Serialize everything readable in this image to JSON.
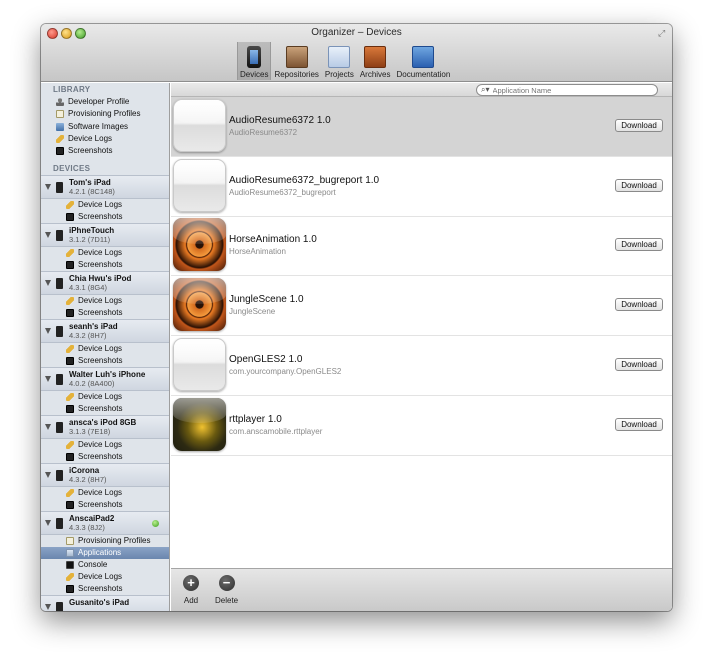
{
  "window": {
    "title": "Organizer – Devices"
  },
  "toolbar": [
    {
      "label": "Devices",
      "icon": "device-icon",
      "active": true
    },
    {
      "label": "Repositories",
      "icon": "repository-icon",
      "active": false
    },
    {
      "label": "Projects",
      "icon": "projects-icon",
      "active": false
    },
    {
      "label": "Archives",
      "icon": "archives-icon",
      "active": false
    },
    {
      "label": "Documentation",
      "icon": "documentation-icon",
      "active": false
    }
  ],
  "sidebar": {
    "library_header": "LIBRARY",
    "library": [
      {
        "label": "Developer Profile",
        "icon": "person-icon"
      },
      {
        "label": "Provisioning Profiles",
        "icon": "profile-icon"
      },
      {
        "label": "Software Images",
        "icon": "images-icon"
      },
      {
        "label": "Device Logs",
        "icon": "logs-icon"
      },
      {
        "label": "Screenshots",
        "icon": "screenshots-icon"
      }
    ],
    "devices_header": "DEVICES",
    "devices": [
      {
        "name": "Tom's iPad",
        "version": "4.2.1 (8C148)",
        "children": [
          "Device Logs",
          "Screenshots"
        ]
      },
      {
        "name": "iPhneTouch",
        "version": "3.1.2 (7D11)",
        "children": [
          "Device Logs",
          "Screenshots"
        ]
      },
      {
        "name": "Chia Hwu's iPod",
        "version": "4.3.1 (8G4)",
        "children": [
          "Device Logs",
          "Screenshots"
        ]
      },
      {
        "name": "seanh's iPad",
        "version": "4.3.2 (8H7)",
        "children": [
          "Device Logs",
          "Screenshots"
        ]
      },
      {
        "name": "Walter Luh's iPhone",
        "version": "4.0.2 (8A400)",
        "children": [
          "Device Logs",
          "Screenshots"
        ]
      },
      {
        "name": "ansca's iPod 8GB",
        "version": "3.1.3 (7E18)",
        "children": [
          "Device Logs",
          "Screenshots"
        ]
      },
      {
        "name": "iCorona",
        "version": "4.3.2 (8H7)",
        "children": [
          "Device Logs",
          "Screenshots"
        ]
      },
      {
        "name": "AnscaiPad2",
        "version": "4.3.3 (8J2)",
        "connected": true,
        "children": [
          "Provisioning Profiles",
          "Applications",
          "Console",
          "Device Logs",
          "Screenshots"
        ],
        "selected_child": "Applications"
      },
      {
        "name": "Gusanito's iPad",
        "version": "",
        "children": []
      }
    ]
  },
  "search": {
    "placeholder": "Application Name"
  },
  "apps": [
    {
      "name": "AudioResume6372 1.0",
      "id": "AudioResume6372",
      "icon": "blank",
      "selected": true
    },
    {
      "name": "AudioResume6372_bugreport 1.0",
      "id": "AudioResume6372_bugreport",
      "icon": "blank",
      "selected": false
    },
    {
      "name": "HorseAnimation 1.0",
      "id": "HorseAnimation",
      "icon": "orange",
      "selected": false
    },
    {
      "name": "JungleScene 1.0",
      "id": "JungleScene",
      "icon": "orange",
      "selected": false
    },
    {
      "name": "OpenGLES2 1.0",
      "id": "com.yourcompany.OpenGLES2",
      "icon": "blank",
      "selected": false
    },
    {
      "name": "rttplayer 1.0",
      "id": "com.anscamobile.rttplayer",
      "icon": "rtt",
      "selected": false
    }
  ],
  "download_label": "Download",
  "bottom": {
    "add_label": "Add",
    "delete_label": "Delete"
  }
}
